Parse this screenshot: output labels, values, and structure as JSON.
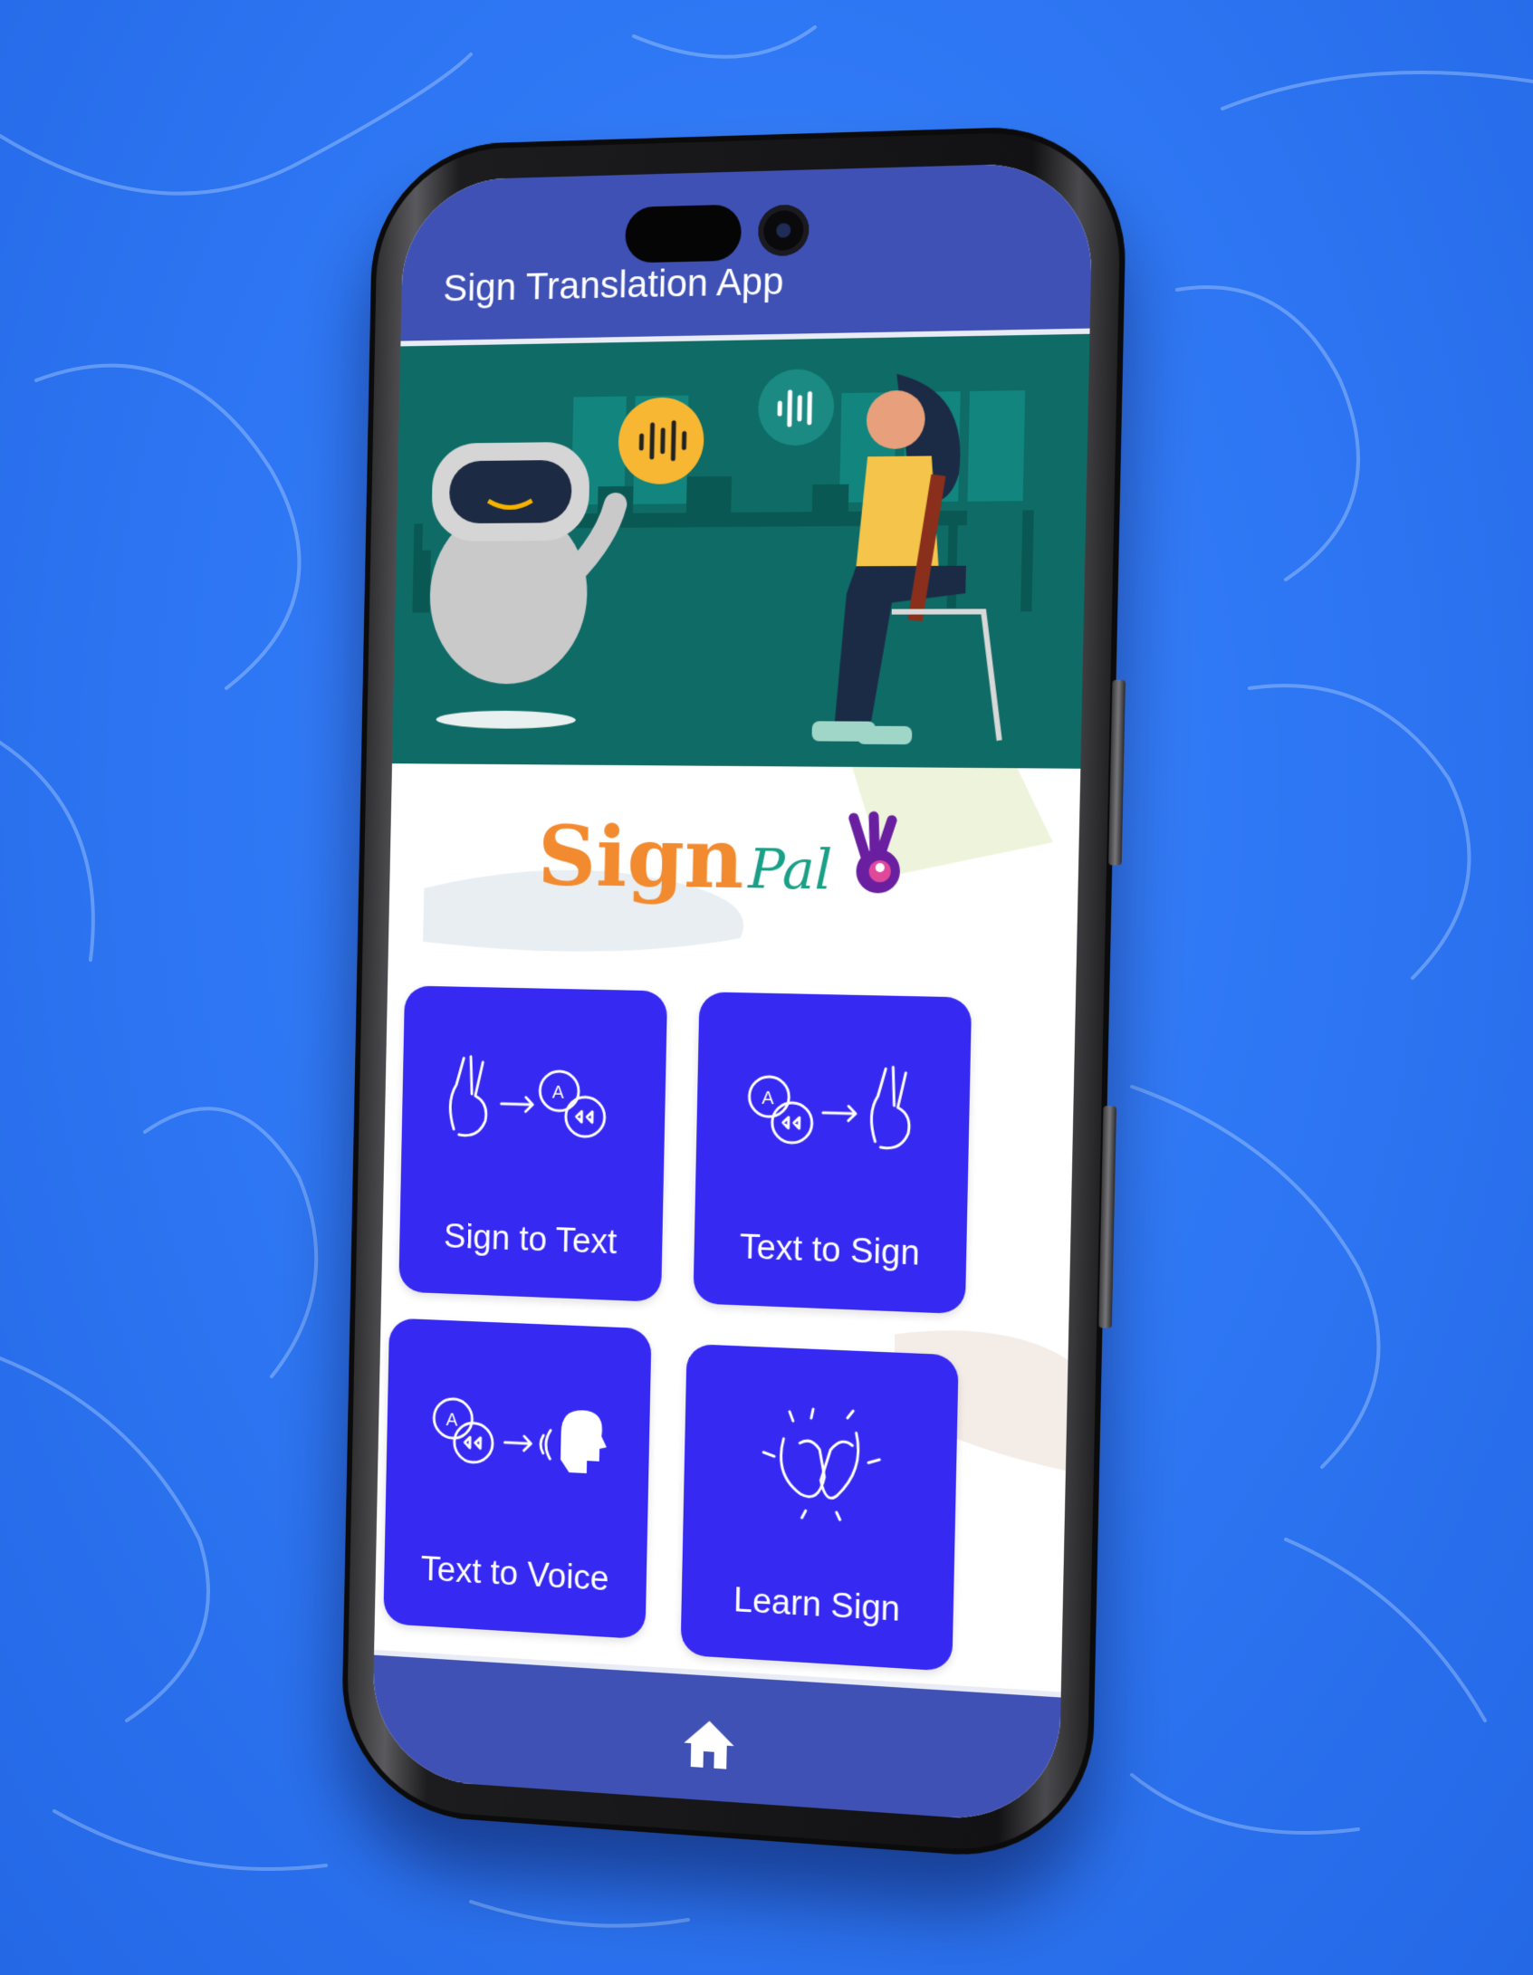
{
  "app": {
    "title": "Sign Translation App"
  },
  "brand": {
    "name_part1": "Sign",
    "name_part2": "Pal"
  },
  "tiles": [
    {
      "label": "Sign to Text",
      "icon": "sign-to-text-icon"
    },
    {
      "label": "Text to Sign",
      "icon": "text-to-sign-icon"
    },
    {
      "label": "Text to Voice",
      "icon": "text-to-voice-icon"
    },
    {
      "label": "Learn Sign",
      "icon": "learn-sign-icon"
    }
  ],
  "bottom_nav": {
    "icon": "home-icon"
  },
  "colors": {
    "background": "#2f78f5",
    "app_bar": "#3f51b5",
    "tile": "#3629f2",
    "hero": "#0e6b66",
    "brand_orange": "#f28a30",
    "brand_teal": "#1aa087",
    "brand_purple": "#6a1fa0"
  }
}
